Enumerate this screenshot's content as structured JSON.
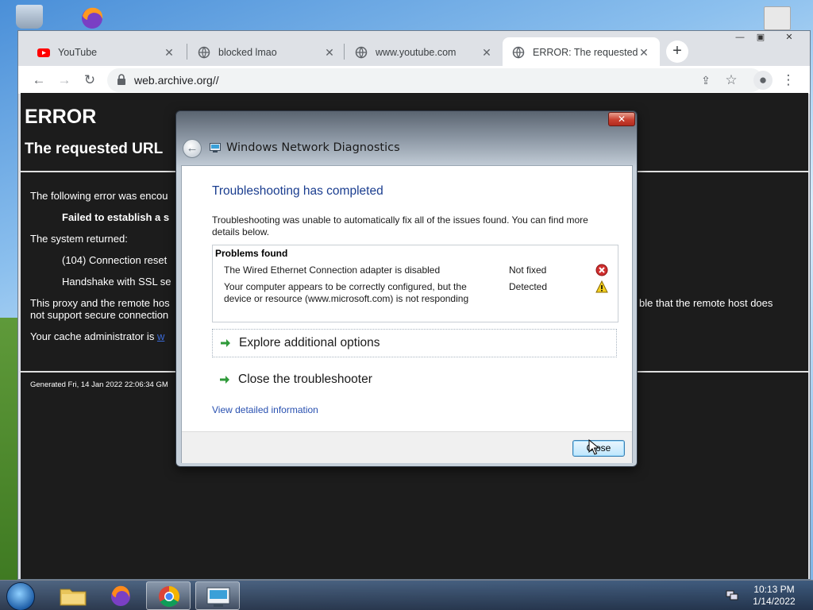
{
  "browser": {
    "tabs": [
      {
        "title": "YouTube",
        "icon": "youtube-icon",
        "active": false
      },
      {
        "title": "blocked lmao",
        "icon": "globe-icon",
        "active": false
      },
      {
        "title": "www.youtube.com",
        "icon": "globe-icon",
        "active": false
      },
      {
        "title": "ERROR: The requested U",
        "icon": "globe-icon",
        "active": true
      }
    ],
    "new_tab": "+",
    "url": "web.archive.org//"
  },
  "page": {
    "h1": "ERROR",
    "h2": "The requested URL",
    "line1": "The following error was encou",
    "line2": "Failed to establish a s",
    "line3": "The system returned:",
    "line4": "(104) Connection reset",
    "line5": "Handshake with SSL se",
    "line6a": "This proxy and the remote hos",
    "line6b": "not support secure connection",
    "line6c": "ble that the remote host does",
    "line7": "Your cache administrator is",
    "line7_link": "w",
    "footer": "Generated Fri, 14 Jan 2022 22:06:34 GM"
  },
  "dialog": {
    "title": "Windows Network Diagnostics",
    "close_x": "✕",
    "heading": "Troubleshooting has completed",
    "description": "Troubleshooting was unable to automatically fix all of the issues found. You can find more details below.",
    "problems_header": "Problems found",
    "problems": [
      {
        "issue": "The Wired Ethernet Connection adapter is disabled",
        "status": "Not fixed",
        "icon": "error-icon"
      },
      {
        "issue": "Your computer appears to be correctly configured, but the device or resource (www.microsoft.com) is not responding",
        "status": "Detected",
        "icon": "warning-icon"
      }
    ],
    "option1": "Explore additional options",
    "option2": "Close the troubleshooter",
    "detail_link": "View detailed information",
    "close_button": "Close"
  },
  "taskbar": {
    "time": "10:13 PM",
    "date": "1/14/2022"
  },
  "colors": {
    "dialog_heading": "#1a3d8f",
    "link": "#2850b0",
    "page_bg": "#1c1c1c"
  }
}
